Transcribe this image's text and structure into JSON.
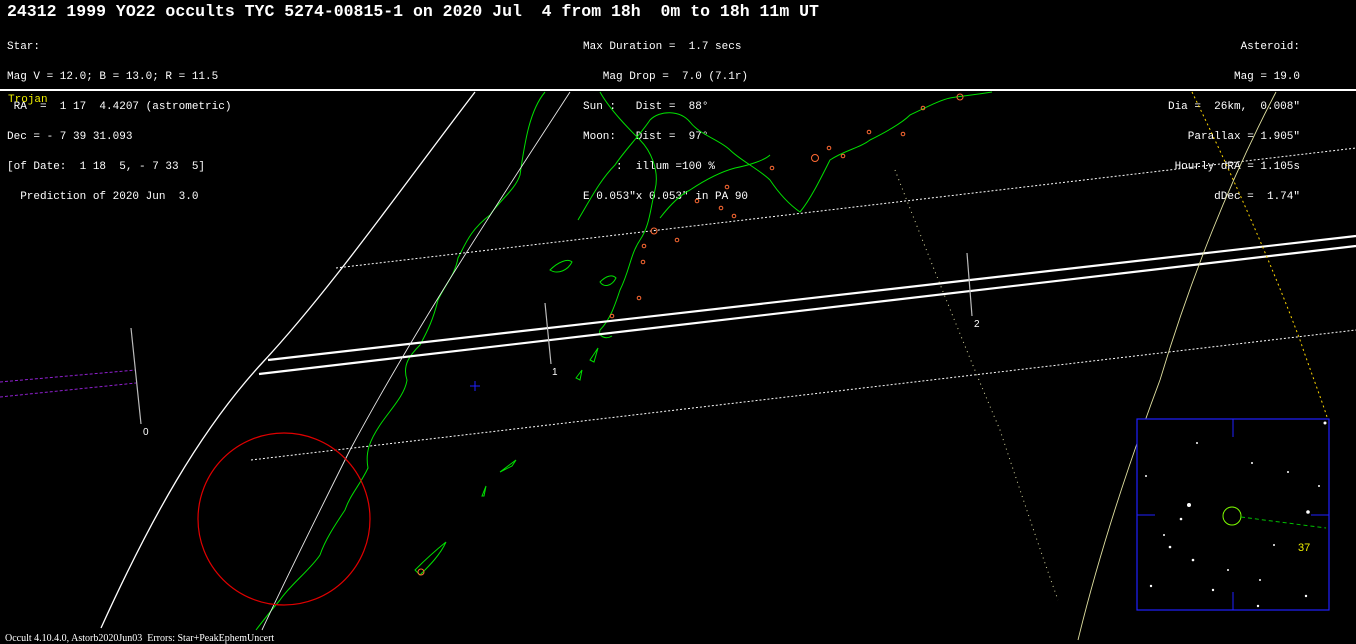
{
  "title": "24312 1999 YO22 occults TYC 5274-00815-1 on 2020 Jul  4 from 18h  0m to 18h 11m UT",
  "star_lines": [
    "Star:",
    "Mag V = 12.0; B = 13.0; R = 11.5",
    " RA  =  1 17  4.4207 (astrometric)",
    "Dec = - 7 39 31.093",
    "[of Date:  1 18  5, - 7 33  5]",
    "  Prediction of 2020 Jun  3.0"
  ],
  "event_lines": [
    "Max Duration =  1.7 secs",
    "   Mag Drop =  7.0 (7.1r)",
    "Sun :   Dist =  88°",
    "Moon:   Dist =  97°",
    "     :  illum =100 %",
    "E 0.053\"x 0.053\" in PA 90"
  ],
  "asteroid_lines": [
    "Asteroid:",
    "Mag = 19.0",
    "Dia =  26km,  0.008\"",
    "Parallax = 1.905\"",
    "Hourly dRA = 1.105s",
    "dDec =  1.74\""
  ],
  "class_tag": "Trojan",
  "footer": "Occult 4.10.4.0, Astorb2020Jun03  Errors: Star+PeakEphemUncert",
  "time_markers": [
    "0",
    "1",
    "2"
  ],
  "finder": {
    "label": "37"
  },
  "colors": {
    "background": "#000000",
    "text": "#ffffff",
    "class_tag": "#f0f000",
    "coastline": "#00e000",
    "central_path": "#ffffff",
    "uncertainty_path": "#ffffff",
    "secondary_path": "#9020d0",
    "observer_circle": "#e00000",
    "sub_point": "#2020ff",
    "finder_frame": "#2020ff",
    "terminator": "#ffd700",
    "cities": "#ff6a33"
  }
}
